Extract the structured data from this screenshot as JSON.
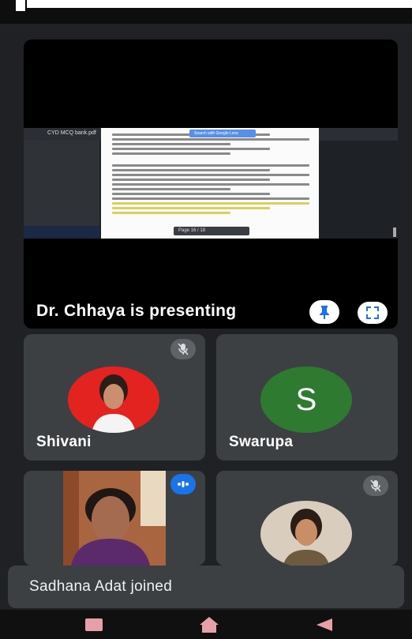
{
  "presentation": {
    "presenter_label": "Dr. Chhaya is presenting",
    "pin_icon": "pin-icon",
    "expand_icon": "fullscreen-icon",
    "shared_screen": {
      "pdf_title": "CYD MCQ bank.pdf",
      "search_chip": "Search with Google Lens",
      "page_indicator": "Page 16 / 18"
    }
  },
  "participants": [
    {
      "name": "Shivani",
      "muted": true,
      "avatar_type": "photo"
    },
    {
      "name": "Swarupa",
      "muted": false,
      "avatar_type": "initial",
      "initial": "S",
      "avatar_color": "#2f7a31"
    },
    {
      "name": "",
      "muted": false,
      "speaking": true,
      "avatar_type": "video"
    },
    {
      "name": "",
      "muted": true,
      "avatar_type": "photo"
    }
  ],
  "toast": {
    "message": "Sadhana Adat joined"
  },
  "navigation": {
    "recent_icon": "recent-apps-icon",
    "home_icon": "home-icon",
    "back_icon": "back-icon"
  },
  "colors": {
    "background": "#202124",
    "tile": "#3c4043",
    "accent_blue": "#1a73e8",
    "nav_pink": "#e8a0a8"
  }
}
